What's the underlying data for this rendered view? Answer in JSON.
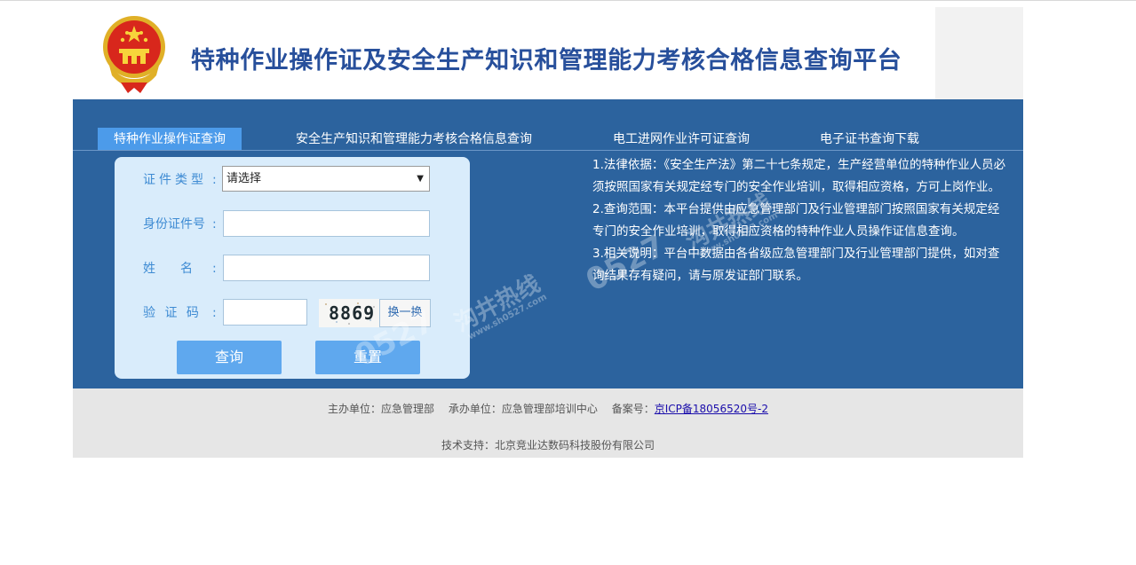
{
  "header": {
    "title": "特种作业操作证及安全生产知识和管理能力考核合格信息查询平台",
    "emblem_icon": "national-emblem-icon"
  },
  "tabs": [
    {
      "label": "特种作业操作证查询",
      "active": true
    },
    {
      "label": "安全生产知识和管理能力考核合格信息查询",
      "active": false
    },
    {
      "label": "电工进网作业许可证查询",
      "active": false
    },
    {
      "label": "电子证书查询下载",
      "active": false
    }
  ],
  "form": {
    "cert_type_label": "证件类型",
    "cert_type_value": "请选择",
    "id_label": "身份证件号",
    "id_value": "",
    "name_label": "姓　　名",
    "name_value": "",
    "captcha_label": "验 证 码",
    "captcha_value": "",
    "captcha_text": "8869",
    "swap_label": "换一换",
    "colon": ":",
    "query_button": "查询",
    "reset_button": "重置"
  },
  "notes": [
    "1.法律依据：《安全生产法》第二十七条规定，生产经营单位的特种作业人员必须按照国家有关规定经专门的安全作业培训，取得相应资格，方可上岗作业。",
    "2.查询范围：本平台提供由应急管理部门及行业管理部门按照国家有关规定经专门的安全作业培训，取得相应资格的特种作业人员操作证信息查询。",
    "3.相关说明：平台中数据由各省级应急管理部门及行业管理部门提供，如对查询结果存有疑问，请与原发证部门联系。"
  ],
  "footer": {
    "host": "主办单位：应急管理部",
    "organizer": "承办单位：应急管理部培训中心",
    "icp_label": "备案号：",
    "icp_link": "京ICP备18056520号-2",
    "tech_support": "技术支持：北京竞业达数码科技股份有限公司"
  },
  "watermark": {
    "brand": "0527",
    "slogan": "沟井热线",
    "url": "www.sh0527.com"
  },
  "colors": {
    "panel": "#2c639e",
    "active_tab": "#4c9bea",
    "title": "#274f9b",
    "button": "#5fa8ee",
    "footer": "#e6e6e6"
  }
}
